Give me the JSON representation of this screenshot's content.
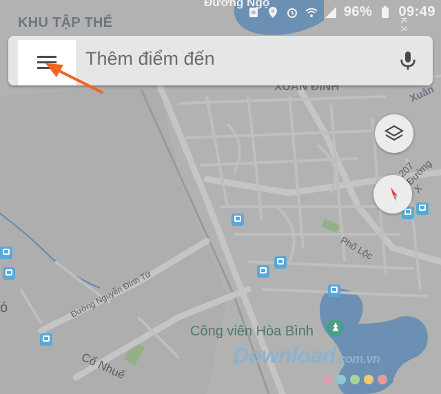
{
  "status_bar": {
    "battery": "96%",
    "time": "09:49",
    "top_street_partial": "Đường Ngọ"
  },
  "search_bar": {
    "menu_icon": "hamburger-menu-icon",
    "placeholder": "Thêm điểm đến",
    "mic_icon": "microphone-icon"
  },
  "map": {
    "area_top": "KHU TẬP THỂ",
    "area_xuan_dinh": "XUÂN ĐỈNH",
    "area_right": "Xuân",
    "street_207": "207 Đường X",
    "street_pho_loc": "Phố Lộc",
    "street_nguyen_dinh_tu": "Đường Nguyễn Đình Tứ",
    "street_co_nhue": "Cổ Nhuế",
    "park": "Công viên Hòa Bình",
    "number_x": "K X",
    "left_char": "ó"
  },
  "controls": {
    "layers_icon": "layers-icon",
    "compass_icon": "compass-icon"
  },
  "watermark": {
    "brand": "Download",
    "domain": ".com.vn",
    "dot_colors": [
      "#d9a0b0",
      "#8fc7d6",
      "#a8d49a",
      "#f0c870",
      "#e89a9a"
    ]
  },
  "colors": {
    "arrow": "#f26422",
    "transit": "#58a9d8",
    "water": "#7aa4cc"
  }
}
